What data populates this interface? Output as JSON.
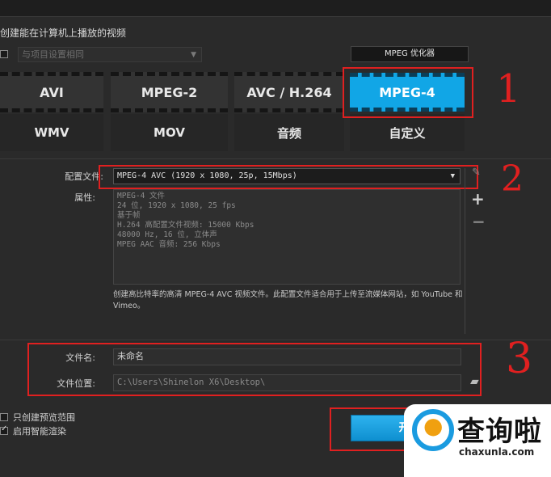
{
  "heading": "创建能在计算机上播放的视频",
  "project_setting_combo": "与项目设置相同",
  "optimizer_label": "MPEG 优化器",
  "formats": {
    "row1": [
      "AVI",
      "MPEG-2",
      "AVC / H.264",
      "MPEG-4"
    ],
    "row2": [
      "WMV",
      "MOV",
      "音频",
      "自定义"
    ],
    "active": "MPEG-4"
  },
  "profile": {
    "label": "配置文件:",
    "value": "MPEG-4 AVC (1920 x 1080, 25p, 15Mbps)"
  },
  "properties": {
    "label": "属性:",
    "lines": [
      "MPEG-4 文件",
      "24 位, 1920 x 1080, 25 fps",
      "基于帧",
      "H.264 高配置文件视频: 15000 Kbps",
      "48000 Hz, 16 位, 立体声",
      "MPEG AAC 音频: 256 Kbps"
    ]
  },
  "description": "创建高比特率的高清 MPEG-4 AVC 视频文件。此配置文件适合用于上传至流媒体网站，如 YouTube 和 Vimeo。",
  "file_name": {
    "label": "文件名:",
    "value": "未命名"
  },
  "file_location": {
    "label": "文件位置:",
    "value": "C:\\Users\\Shinelon X6\\Desktop\\"
  },
  "options": {
    "preview_range": "只创建预览范围",
    "smart_render": "启用智能渲染"
  },
  "start_button": "开",
  "annotations": [
    "1",
    "2",
    "3"
  ],
  "watermark": {
    "brand": "查询啦",
    "url": "chaxunla.com"
  },
  "colors": {
    "accent": "#11a6e6",
    "highlight": "#e02020"
  }
}
